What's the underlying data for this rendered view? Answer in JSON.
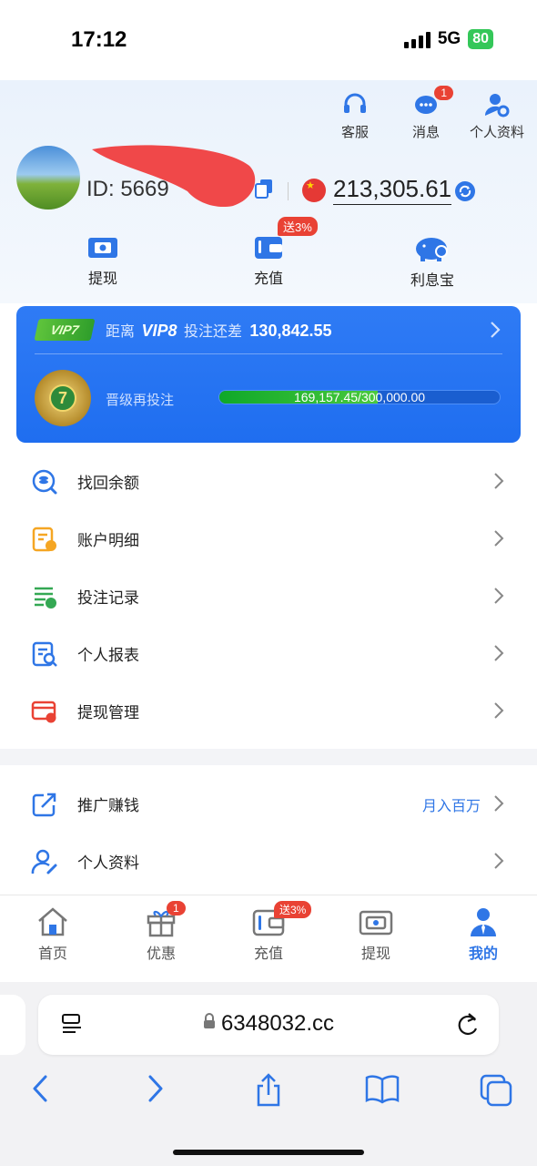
{
  "status": {
    "time": "17:12",
    "network": "5G",
    "battery": "80"
  },
  "header": {
    "actions": [
      {
        "label": "客服",
        "icon": "headset-icon"
      },
      {
        "label": "消息",
        "icon": "chat-icon",
        "badge": "1"
      },
      {
        "label": "个人资料",
        "icon": "user-settings-icon"
      }
    ],
    "user_id": "ID: 5669",
    "balance": "213,305.61",
    "quick_actions": [
      {
        "label": "提现",
        "icon": "withdraw-icon"
      },
      {
        "label": "充值",
        "icon": "wallet-icon",
        "badge": "送3%"
      },
      {
        "label": "利息宝",
        "icon": "piggy-bank-icon"
      }
    ]
  },
  "vip": {
    "current_tag": "VIP7",
    "distance_prefix": "距离",
    "next_level": "VIP8",
    "distance_suffix": "投注还差",
    "remaining": "130,842.55",
    "medal_level": "7",
    "upgrade_label": "晋级再投注",
    "progress_text": "169,157.45/300,000.00",
    "progress_fraction": 0.5639
  },
  "menu_primary": [
    {
      "label": "找回余额",
      "icon": "recover-balance-icon",
      "color": "#2f76e6"
    },
    {
      "label": "账户明细",
      "icon": "account-details-icon",
      "color": "#f5a623"
    },
    {
      "label": "投注记录",
      "icon": "bet-records-icon",
      "color": "#34a853"
    },
    {
      "label": "个人报表",
      "icon": "report-icon",
      "color": "#2f76e6"
    },
    {
      "label": "提现管理",
      "icon": "withdraw-manage-icon",
      "color": "#e94234"
    }
  ],
  "menu_secondary": [
    {
      "label": "推广赚钱",
      "icon": "share-icon",
      "extra": "月入百万",
      "color": "#2f76e6"
    },
    {
      "label": "个人资料",
      "icon": "profile-edit-icon",
      "color": "#2f76e6"
    }
  ],
  "tabs": [
    {
      "label": "首页",
      "icon": "home-icon"
    },
    {
      "label": "优惠",
      "icon": "gift-icon",
      "badge": "1"
    },
    {
      "label": "充值",
      "icon": "wallet-icon",
      "badge": "送3%"
    },
    {
      "label": "提现",
      "icon": "withdraw-icon"
    },
    {
      "label": "我的",
      "icon": "person-icon",
      "active": true
    }
  ],
  "browser": {
    "url": "6348032.cc"
  },
  "colors": {
    "accent": "#2f76e6",
    "badge": "#e94234",
    "progress": "#0fa829"
  }
}
